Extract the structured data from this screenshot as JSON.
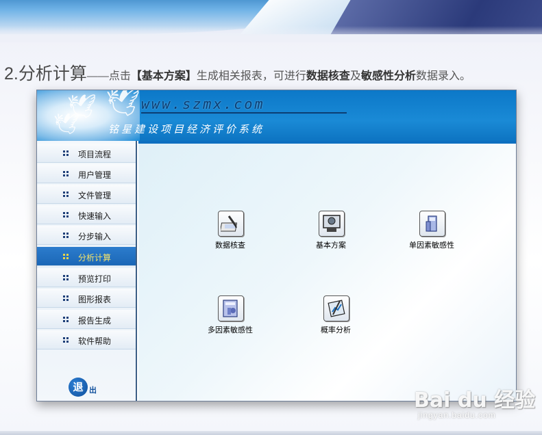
{
  "caption": {
    "step": "2.分析计算",
    "dash": "——",
    "prefix": "点击",
    "bracket_term": "【基本方案】",
    "middle": "生成相关报表，可进行",
    "term1": "数据核查",
    "joiner": "及",
    "term2": "敏感性分析",
    "suffix": "数据录入。"
  },
  "header": {
    "url": "www.szmx.com",
    "system_title": "铭星建设项目经济评价系统"
  },
  "sidebar": {
    "items": [
      {
        "label": "项目流程",
        "active": false
      },
      {
        "label": "用户管理",
        "active": false
      },
      {
        "label": "文件管理",
        "active": false
      },
      {
        "label": "快速输入",
        "active": false
      },
      {
        "label": "分步输入",
        "active": false
      },
      {
        "label": "分析计算",
        "active": true
      },
      {
        "label": "预览打印",
        "active": false
      },
      {
        "label": "图形报表",
        "active": false
      },
      {
        "label": "报告生成",
        "active": false
      },
      {
        "label": "软件帮助",
        "active": false
      }
    ],
    "exit": {
      "main": "退",
      "sub": "出"
    }
  },
  "main": {
    "functions": [
      {
        "label": "数据核查",
        "icon": "data-check-icon"
      },
      {
        "label": "基本方案",
        "icon": "basic-plan-icon"
      },
      {
        "label": "单因素敏感性",
        "icon": "single-factor-icon"
      },
      {
        "label": "多因素敏感性",
        "icon": "multi-factor-icon"
      },
      {
        "label": "概率分析",
        "icon": "probability-icon"
      }
    ]
  },
  "colors": {
    "header_blue": "#0c78c8",
    "sidebar_active": "#2c7ccd",
    "active_text": "#f5e36a"
  },
  "watermark": {
    "logo": "Bai du 经验",
    "url": "jingyan.baidu.com"
  }
}
